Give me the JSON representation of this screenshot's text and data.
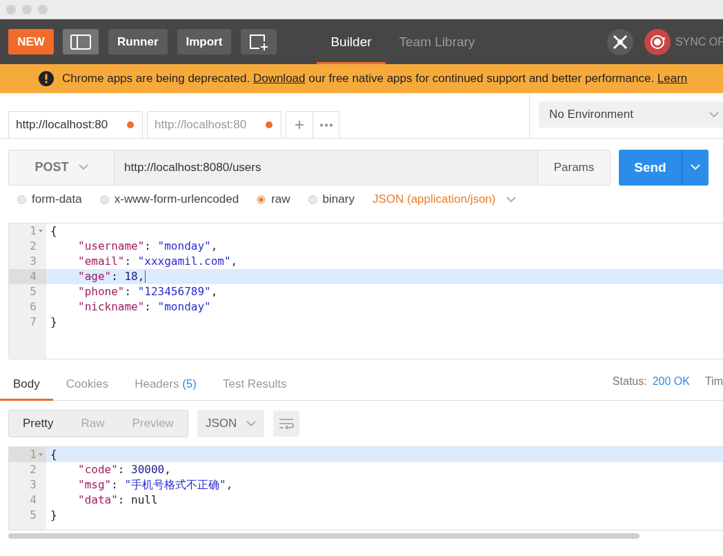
{
  "toolbar": {
    "new_button": "NEW",
    "buttons": [
      "Runner",
      "Import"
    ],
    "tabs": [
      {
        "label": "Builder",
        "selected": true
      },
      {
        "label": "Team Library",
        "selected": false
      }
    ],
    "sync_label": "SYNC OF"
  },
  "banner": {
    "parts": [
      {
        "kind": "text",
        "text": "Chrome apps are being deprecated. "
      },
      {
        "kind": "link",
        "text": "Download"
      },
      {
        "kind": "text",
        "text": " our free native apps for continued support and better performance. "
      },
      {
        "kind": "link",
        "text": "Learn"
      }
    ]
  },
  "request_tabs": [
    {
      "label": "http://localhost:80",
      "selected": true,
      "unsaved": true
    },
    {
      "label": "http://localhost:80",
      "selected": false,
      "unsaved": true
    }
  ],
  "environment": {
    "value": "No Environment"
  },
  "request": {
    "method": "POST",
    "url": "http://localhost:8080/users",
    "params_button": "Params",
    "send_button": "Send"
  },
  "body_types": [
    {
      "label": "form-data",
      "selected": false
    },
    {
      "label": "x-www-form-urlencoded",
      "selected": false
    },
    {
      "label": "raw",
      "selected": true
    },
    {
      "label": "binary",
      "selected": false
    }
  ],
  "body_format": "JSON (application/json)",
  "request_body": {
    "lines": [
      {
        "number": "1",
        "foldable": true,
        "highlighted": false,
        "indented": false,
        "cursor": false,
        "tokens": [
          {
            "kind": "punct",
            "text": "{"
          }
        ]
      },
      {
        "number": "2",
        "foldable": false,
        "highlighted": false,
        "indented": true,
        "cursor": false,
        "tokens": [
          {
            "kind": "key",
            "text": "\"username\""
          },
          {
            "kind": "punct",
            "text": ": "
          },
          {
            "kind": "string",
            "text": "\"monday\""
          },
          {
            "kind": "punct",
            "text": ","
          }
        ]
      },
      {
        "number": "3",
        "foldable": false,
        "highlighted": false,
        "indented": true,
        "cursor": false,
        "tokens": [
          {
            "kind": "key",
            "text": "\"email\""
          },
          {
            "kind": "punct",
            "text": ": "
          },
          {
            "kind": "string",
            "text": "\"xxxgamil.com\""
          },
          {
            "kind": "punct",
            "text": ","
          }
        ]
      },
      {
        "number": "4",
        "foldable": false,
        "highlighted": true,
        "indented": true,
        "cursor": true,
        "tokens": [
          {
            "kind": "key",
            "text": "\"age\""
          },
          {
            "kind": "punct",
            "text": ": "
          },
          {
            "kind": "number",
            "text": "18"
          },
          {
            "kind": "punct",
            "text": ","
          }
        ]
      },
      {
        "number": "5",
        "foldable": false,
        "highlighted": false,
        "indented": true,
        "cursor": false,
        "tokens": [
          {
            "kind": "key",
            "text": "\"phone\""
          },
          {
            "kind": "punct",
            "text": ": "
          },
          {
            "kind": "string",
            "text": "\"123456789\""
          },
          {
            "kind": "punct",
            "text": ","
          }
        ]
      },
      {
        "number": "6",
        "foldable": false,
        "highlighted": false,
        "indented": true,
        "cursor": false,
        "tokens": [
          {
            "kind": "key",
            "text": "\"nickname\""
          },
          {
            "kind": "punct",
            "text": ": "
          },
          {
            "kind": "string",
            "text": "\"monday\""
          }
        ]
      },
      {
        "number": "7",
        "foldable": false,
        "highlighted": false,
        "indented": false,
        "cursor": false,
        "tokens": [
          {
            "kind": "punct",
            "text": "}"
          }
        ]
      }
    ]
  },
  "response_tabs": [
    {
      "label": "Body",
      "selected": true
    },
    {
      "label": "Cookies",
      "selected": false
    },
    {
      "label": "Headers",
      "count": "(5)",
      "selected": false
    },
    {
      "label": "Test Results",
      "selected": false
    }
  ],
  "status": {
    "label": "Status:",
    "value": "200 OK",
    "next_label": "Tim"
  },
  "view_modes": [
    {
      "label": "Pretty",
      "selected": true
    },
    {
      "label": "Raw",
      "selected": false
    },
    {
      "label": "Preview",
      "selected": false
    }
  ],
  "response_format": "JSON",
  "response_body": {
    "lines": [
      {
        "number": "1",
        "foldable": true,
        "highlighted": true,
        "indented": false,
        "cursor": false,
        "tokens": [
          {
            "kind": "punct",
            "text": "{"
          }
        ]
      },
      {
        "number": "2",
        "foldable": false,
        "highlighted": false,
        "indented": true,
        "cursor": false,
        "tokens": [
          {
            "kind": "key",
            "text": "\"code\""
          },
          {
            "kind": "punct",
            "text": ": "
          },
          {
            "kind": "number",
            "text": "30000"
          },
          {
            "kind": "punct",
            "text": ","
          }
        ]
      },
      {
        "number": "3",
        "foldable": false,
        "highlighted": false,
        "indented": true,
        "cursor": false,
        "tokens": [
          {
            "kind": "key",
            "text": "\"msg\""
          },
          {
            "kind": "punct",
            "text": ": "
          },
          {
            "kind": "string",
            "text": "\"手机号格式不正确\""
          },
          {
            "kind": "punct",
            "text": ","
          }
        ]
      },
      {
        "number": "4",
        "foldable": false,
        "highlighted": false,
        "indented": true,
        "cursor": false,
        "tokens": [
          {
            "kind": "key",
            "text": "\"data\""
          },
          {
            "kind": "punct",
            "text": ": "
          },
          {
            "kind": "null",
            "text": "null"
          }
        ]
      },
      {
        "number": "5",
        "foldable": false,
        "highlighted": false,
        "indented": false,
        "cursor": false,
        "tokens": [
          {
            "kind": "punct",
            "text": "}"
          }
        ]
      }
    ]
  }
}
